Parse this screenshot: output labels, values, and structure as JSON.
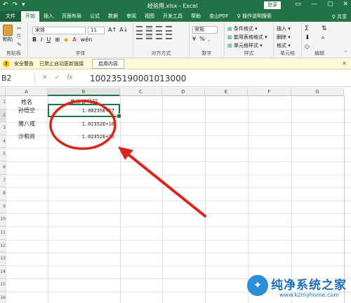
{
  "titlebar": {
    "quick_access": [
      "↶",
      "↷",
      "▾"
    ],
    "title": "经验用.xlsx - Excel",
    "login": "登录",
    "window_buttons": [
      "▭",
      "—",
      "▢",
      "✕"
    ]
  },
  "tabs": [
    "文件",
    "开始",
    "插入",
    "页面布局",
    "公式",
    "数据",
    "审阅",
    "视图",
    "开发工具",
    "帮助",
    "金山PDF",
    "操作说明搜索"
  ],
  "tabs_right": [
    "共享"
  ],
  "ribbon": {
    "clipboard": {
      "paste": "粘贴",
      "label": "剪贴板"
    },
    "font": {
      "name": "宋体",
      "size": "11",
      "label": "字体"
    },
    "alignment": {
      "label": "对齐方式"
    },
    "number": {
      "format": "常规",
      "label": "数字"
    },
    "styles": {
      "items": [
        "条件格式 ▾",
        "套用表格格式 ▾",
        "单元格样式 ▾"
      ],
      "label": "样式"
    },
    "cells": {
      "items": [
        "插入 ▾",
        "删除 ▾",
        "格式 ▾"
      ],
      "label": "单元格"
    },
    "editing": {
      "label": "编辑"
    }
  },
  "security_bar": {
    "label": "安全警告",
    "message": "已禁止自动更新链接",
    "enable_button": "启用内容",
    "close": "✕"
  },
  "formula_bar": {
    "name_box": "B2",
    "cancel": "✕",
    "confirm": "✓",
    "fx": "fx",
    "formula": "100235190001013000"
  },
  "columns": [
    "A",
    "B",
    "C",
    "D",
    "E",
    "F",
    "G"
  ],
  "rows": [
    "1",
    "2",
    "3",
    "4",
    "5",
    "6",
    "7",
    "8",
    "9",
    "10",
    "11",
    "12",
    "13",
    "14",
    "15",
    "16"
  ],
  "cells": {
    "a1": "姓名",
    "b1": "身份证号码",
    "a2": "孙悟空",
    "b2": "1.00235E+17",
    "a3": "猪八戒",
    "b3": "1.02352E+16",
    "a4": "沙和尚",
    "b4": "1.02352E+16"
  },
  "watermark": {
    "logo": "✦",
    "text": "纯净系统之家",
    "url": "www.kzmyhome.com"
  },
  "colors": {
    "excel_green": "#217346",
    "annotation_red": "#d9261c",
    "warning_yellow": "#fff8d6"
  }
}
